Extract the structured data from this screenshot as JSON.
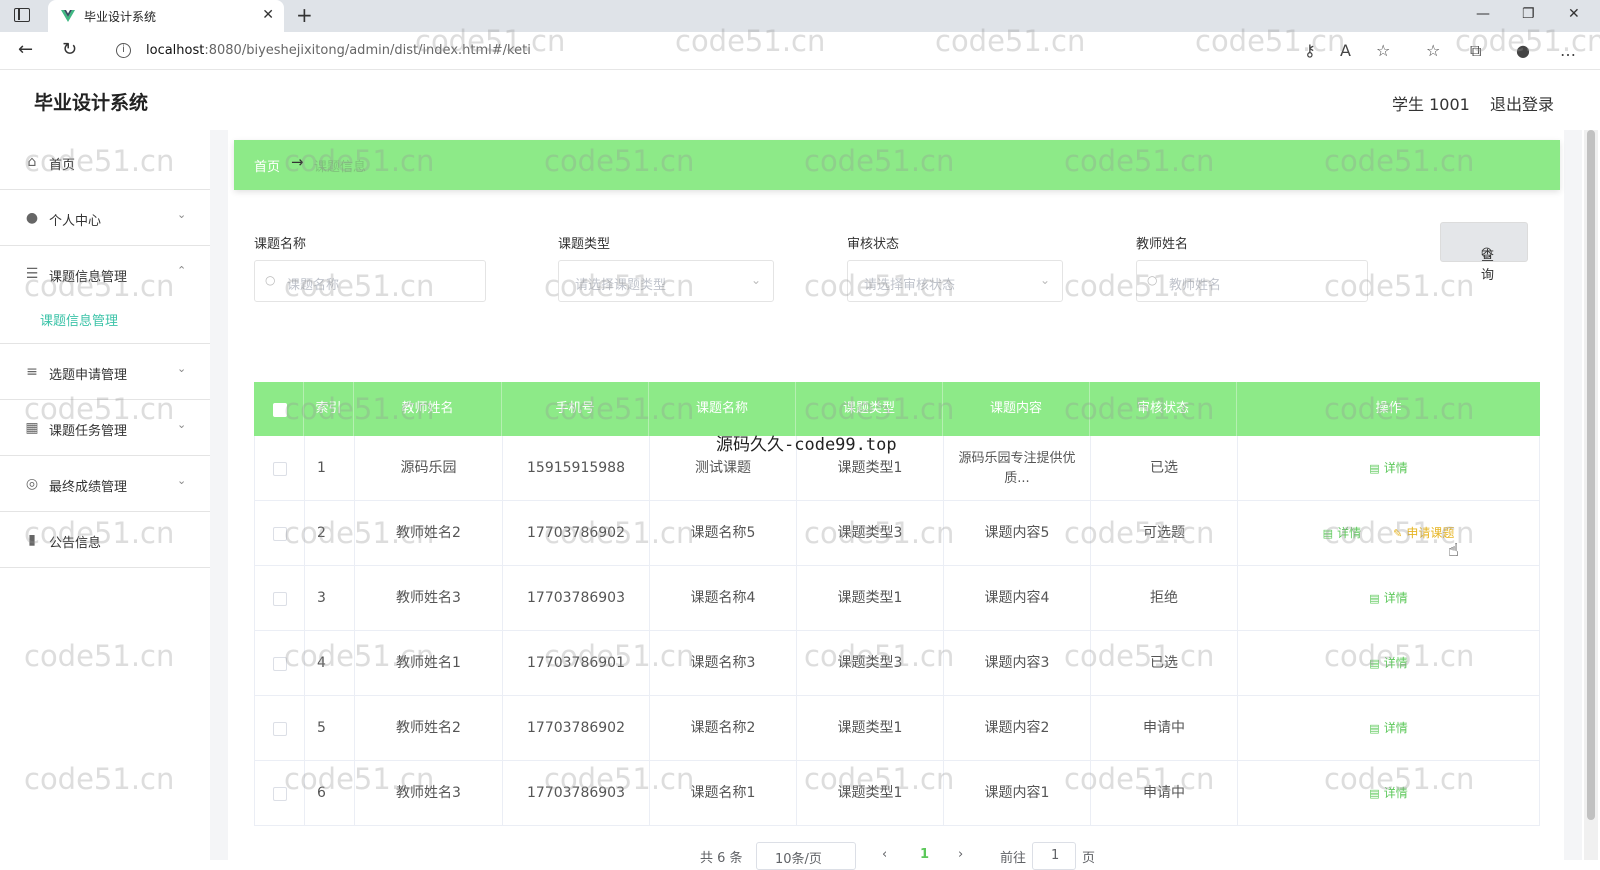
{
  "browser": {
    "tab_title": "毕业设计系统",
    "url_host": "localhost",
    "url_rest": ":8080/biyeshejixitong/admin/dist/index.html#/keti"
  },
  "header": {
    "title": "毕业设计系统",
    "user": "学生 1001",
    "logout": "退出登录"
  },
  "sidebar": {
    "items": [
      {
        "label": "首页",
        "icon": "home-icon"
      },
      {
        "label": "个人中心",
        "icon": "user-icon"
      },
      {
        "label": "课题信息管理",
        "icon": "sliders-icon"
      },
      {
        "label": "选题申请管理",
        "icon": "list-icon"
      },
      {
        "label": "课题任务管理",
        "icon": "chart-icon"
      },
      {
        "label": "最终成绩管理",
        "icon": "target-icon"
      },
      {
        "label": "公告信息",
        "icon": "book-icon"
      }
    ],
    "sub_item": "课题信息管理"
  },
  "breadcrumb": {
    "home": "首页",
    "separator": "→",
    "current": "课题信息"
  },
  "search": {
    "fields": [
      {
        "label": "课题名称",
        "placeholder": "课题名称"
      },
      {
        "label": "课题类型",
        "placeholder": "请选择课题类型"
      },
      {
        "label": "审核状态",
        "placeholder": "请选择审核状态"
      },
      {
        "label": "教师姓名",
        "placeholder": "教师姓名"
      }
    ],
    "query_button": "查询"
  },
  "table": {
    "headers": [
      "索引",
      "教师姓名",
      "手机号",
      "课题名称",
      "课题类型",
      "课题内容",
      "审核状态",
      "操作"
    ],
    "rows": [
      {
        "index": "1",
        "teacher": "源码乐园",
        "phone": "15915915988",
        "name": "测试课题",
        "type": "课题类型1",
        "content": "源码乐园专注提供优质...",
        "status": "已选"
      },
      {
        "index": "2",
        "teacher": "教师姓名2",
        "phone": "17703786902",
        "name": "课题名称5",
        "type": "课题类型3",
        "content": "课题内容5",
        "status": "可选题"
      },
      {
        "index": "3",
        "teacher": "教师姓名3",
        "phone": "17703786903",
        "name": "课题名称4",
        "type": "课题类型1",
        "content": "课题内容4",
        "status": "拒绝"
      },
      {
        "index": "4",
        "teacher": "教师姓名1",
        "phone": "17703786901",
        "name": "课题名称3",
        "type": "课题类型3",
        "content": "课题内容3",
        "status": "已选"
      },
      {
        "index": "5",
        "teacher": "教师姓名2",
        "phone": "17703786902",
        "name": "课题名称2",
        "type": "课题类型1",
        "content": "课题内容2",
        "status": "申请中"
      },
      {
        "index": "6",
        "teacher": "教师姓名3",
        "phone": "17703786903",
        "name": "课题名称1",
        "type": "课题类型1",
        "content": "课题内容1",
        "status": "申请中"
      }
    ],
    "detail_label": "详情",
    "apply_label": "申请课题"
  },
  "pager": {
    "total": "共 6 条",
    "page_size": "10条/页",
    "current_page": "1",
    "goto_label": "前往",
    "goto_value": "1",
    "page_suffix": "页"
  },
  "watermark": {
    "text": "code51.cn",
    "center": "源码久久-code99.top"
  },
  "colors": {
    "accent_green": "#8dea88",
    "action_green": "#5cc85a",
    "apply_yellow": "#e6b422",
    "submenu_teal": "#3cc3a8"
  }
}
